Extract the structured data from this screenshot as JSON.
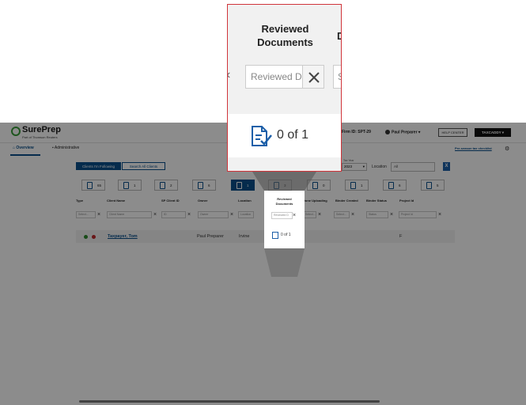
{
  "header": {
    "brand": "SurePrep",
    "brand_sub": "Part of Thomson Reuters",
    "firm_label": "Firm ID: SPT-29",
    "user_label": "Paul Preparer",
    "help_label": "HELP CENTER",
    "taxcaddy_label": "TAXCADDY"
  },
  "nav": {
    "tabs": [
      {
        "label": "Overview"
      },
      {
        "label": "Administrative"
      }
    ],
    "checklist_link": "Pre-season tax checklist"
  },
  "filters": {
    "segments": [
      "Clients I'm Following",
      "Search All Clients"
    ],
    "tax_year_label": "Tax Year",
    "tax_year": "2023",
    "location_label": "Location",
    "location_value": "All"
  },
  "tiles": [
    {
      "icon": "person-icon",
      "count": "65"
    },
    {
      "icon": "comment-icon",
      "count": "1"
    },
    {
      "icon": "clipboard-icon",
      "count": "2"
    },
    {
      "icon": "document-icon",
      "count": "6"
    },
    {
      "icon": "reviewed-doc-icon",
      "count": "1"
    },
    {
      "icon": "document-icon",
      "count": "3"
    },
    {
      "icon": "upload-icon",
      "count": "0"
    },
    {
      "icon": "binder-icon",
      "count": "1"
    },
    {
      "icon": "doc-share-icon",
      "count": "6"
    },
    {
      "icon": "doc-plus-icon",
      "count": "5"
    }
  ],
  "columns": [
    "Type",
    "Client Name",
    "SP Client ID",
    "Owner",
    "Location",
    "Reviewed Documents",
    "Done Uploading",
    "Binder Created",
    "Binder Status",
    "Project Id"
  ],
  "filter_row": {
    "type": "Select...",
    "client_name": "Client Name",
    "sp_client_id": "ID",
    "owner": "Owner",
    "location": "Location",
    "reviewed": "Reviewed D",
    "done_uploading": "Select...",
    "binder_created": "Select...",
    "binder_status": "Status",
    "project_id": "Project Id"
  },
  "row": {
    "client_name": "Taxpayer, Tom",
    "owner": "Paul Preparer",
    "location": "Irvine",
    "reviewed": "0 of 1",
    "binder_status": "F"
  },
  "lens": {
    "heading_line1": "Reviewed",
    "heading_line2": "Documents",
    "next_heading_partial": "D",
    "input_placeholder": "Reviewed D",
    "next_input_partial": "S",
    "count": "0 of 1"
  },
  "colors": {
    "accent": "#0a4f8a",
    "lens_border": "#d0343a",
    "status_green": "#2e8b2e",
    "status_red": "#c0282d"
  }
}
